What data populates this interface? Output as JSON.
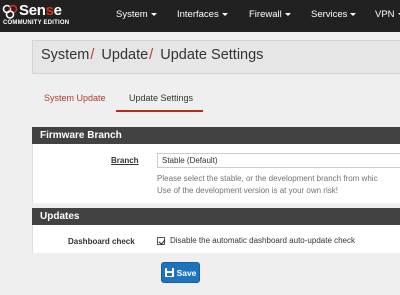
{
  "brand": {
    "name_part1": "Sen",
    "name_highlight": "s",
    "name_part2": "e",
    "edition": "COMMUNITY EDITION"
  },
  "nav": {
    "items": [
      {
        "label": "System"
      },
      {
        "label": "Interfaces"
      },
      {
        "label": "Firewall"
      },
      {
        "label": "Services"
      },
      {
        "label": "VPN"
      }
    ]
  },
  "breadcrumb": {
    "items": [
      "System",
      "Update",
      "Update Settings"
    ],
    "separator": "/"
  },
  "tabs": [
    {
      "label": "System Update",
      "active": false
    },
    {
      "label": "Update Settings",
      "active": true
    }
  ],
  "firmware": {
    "title": "Firmware Branch",
    "branch_label": "Branch",
    "branch_value": "Stable (Default)",
    "help_line1": "Please select the stable, or the development branch from whic",
    "help_line2": "Use of the development version is at your own risk!"
  },
  "updates": {
    "title": "Updates",
    "dashboard_label": "Dashboard check",
    "dashboard_checked": true,
    "dashboard_text": "Disable the automatic dashboard auto-update check"
  },
  "save_button": {
    "label": "Save"
  },
  "colors": {
    "accent": "#b52b1e",
    "navbar": "#212121",
    "panel_header": "#424242",
    "primary": "#1e73be"
  }
}
